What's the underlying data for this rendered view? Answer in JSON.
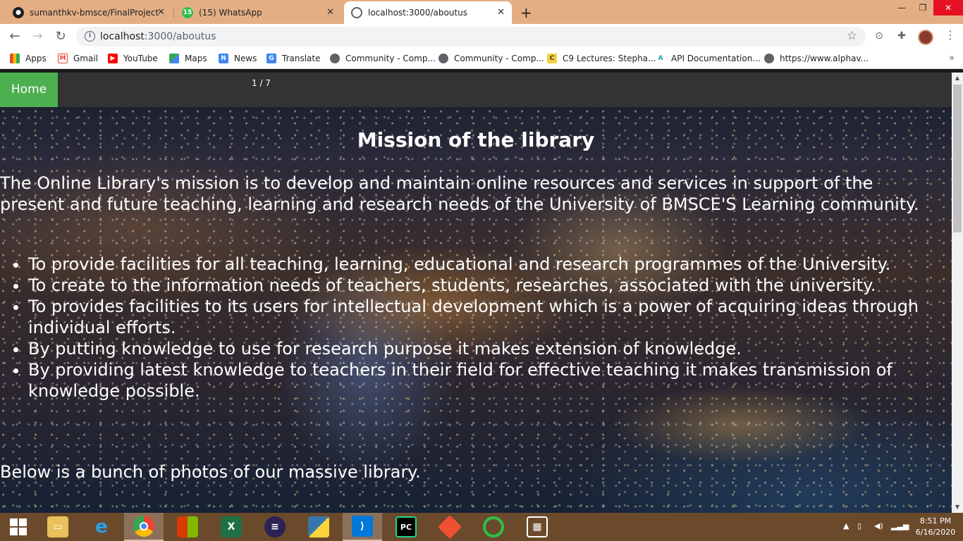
{
  "browser": {
    "tabs": [
      {
        "title": "sumanthkv-bmsce/FinalProject",
        "icon": "github-icon"
      },
      {
        "title": "(15) WhatsApp",
        "icon": "whatsapp-icon",
        "badge": "15"
      },
      {
        "title": "localhost:3000/aboutus",
        "icon": "globe-icon",
        "active": true
      }
    ],
    "url_host": "localhost",
    "url_path": ":3000/aboutus",
    "bookmarks": [
      {
        "label": "Apps",
        "icon": "apps-grid-icon"
      },
      {
        "label": "Gmail",
        "icon": "gmail-icon"
      },
      {
        "label": "YouTube",
        "icon": "youtube-icon"
      },
      {
        "label": "Maps",
        "icon": "maps-icon"
      },
      {
        "label": "News",
        "icon": "news-icon"
      },
      {
        "label": "Translate",
        "icon": "translate-icon"
      },
      {
        "label": "Community - Comp...",
        "icon": "globe-icon"
      },
      {
        "label": "Community - Comp...",
        "icon": "globe-icon"
      },
      {
        "label": "C9 Lectures: Stepha...",
        "icon": "c9-icon"
      },
      {
        "label": "API Documentation...",
        "icon": "api-icon"
      },
      {
        "label": "https://www.alphav...",
        "icon": "globe-icon"
      }
    ],
    "bookmarks_more": "»"
  },
  "page": {
    "nav": {
      "home_label": "Home",
      "slide_counter": "1 / 7"
    },
    "mission_title": "Mission of the library",
    "intro": "The Online Library's mission is to develop and maintain online resources and services in support of the present and future teaching, learning and research needs of the University of BMSCE'S Learning community.",
    "goals": [
      "To provide facilities for all teaching, learning, educational and research programmes of the University.",
      "To create to the information needs of teachers, students, researches, associated with the university.",
      "To provides facilities to its users for intellectual development which is a power of acquiring ideas through individual efforts.",
      "By putting knowledge to use for research purpose it makes extension of knowledge.",
      "By providing latest knowledge to teachers in their field for effective teaching it makes transmission of knowledge possible."
    ],
    "below_text": "Below is a bunch of photos of our massive library."
  },
  "taskbar": {
    "clock_time": "8:51 PM",
    "clock_date": "6/16/2020",
    "apps": [
      "file-explorer-icon",
      "internet-explorer-icon",
      "chrome-icon",
      "office-icon",
      "excel-icon",
      "eclipse-icon",
      "python-icon",
      "vscode-icon",
      "pycharm-icon",
      "git-icon",
      "circle-app-icon",
      "building-app-icon"
    ]
  },
  "colors": {
    "tabstrip": "#e4ae85",
    "home_button": "#4caf50",
    "navbar": "#333333",
    "taskbar": "#6b4a2c"
  }
}
